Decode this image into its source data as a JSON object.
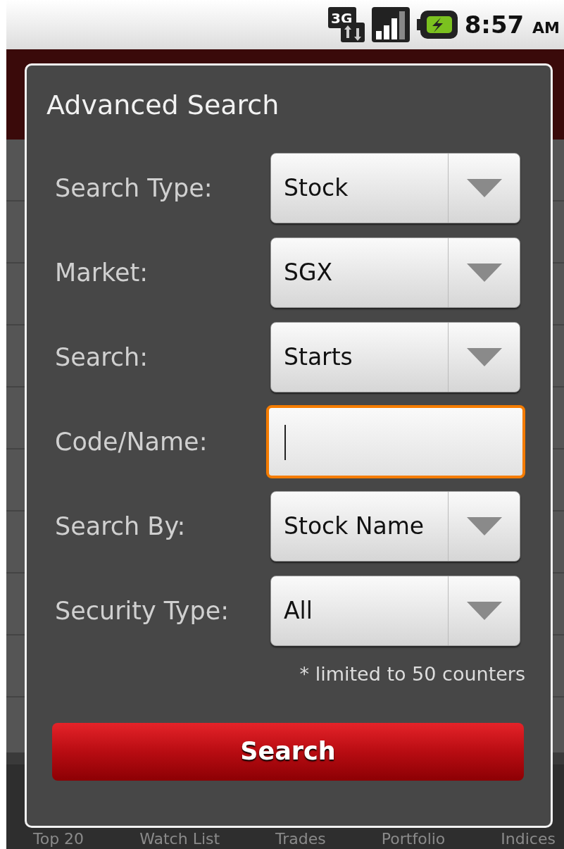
{
  "status_bar": {
    "network": "3G",
    "time": "8:57",
    "meridiem": "AM"
  },
  "dialog": {
    "title": "Advanced Search",
    "fields": [
      {
        "kind": "dropdown",
        "label": "Search Type:",
        "value": "Stock"
      },
      {
        "kind": "dropdown",
        "label": "Market:",
        "value": "SGX"
      },
      {
        "kind": "dropdown",
        "label": "Search:",
        "value": "Starts"
      },
      {
        "kind": "text",
        "label": "Code/Name:",
        "focused": true
      },
      {
        "kind": "dropdown",
        "label": "Search By:",
        "value": "Stock Name"
      },
      {
        "kind": "dropdown",
        "label": "Security Type:",
        "value": "All"
      }
    ],
    "note": "* limited to 50 counters",
    "button": "Search"
  },
  "bottom_tabs": [
    {
      "label": "Top 20"
    },
    {
      "label": "Watch List"
    },
    {
      "label": "Trades"
    },
    {
      "label": "Portfolio"
    },
    {
      "label": "Indices"
    }
  ]
}
